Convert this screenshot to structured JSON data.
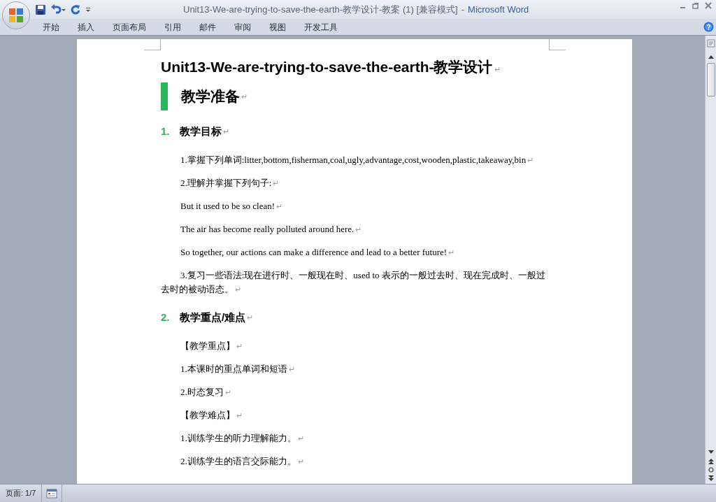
{
  "window": {
    "title": "Unit13-We-are-trying-to-save-the-earth-教学设计-教案 (1) [兼容模式]",
    "separator": "-",
    "app_name": "Microsoft Word"
  },
  "ribbon_tabs": [
    {
      "label": "开始"
    },
    {
      "label": "插入"
    },
    {
      "label": "页面布局"
    },
    {
      "label": "引用"
    },
    {
      "label": "邮件"
    },
    {
      "label": "审阅"
    },
    {
      "label": "视图"
    },
    {
      "label": "开发工具"
    }
  ],
  "document": {
    "blocks": [
      {
        "kind": "title",
        "text": "Unit13-We-are-trying-to-save-the-earth-教学设计",
        "end_mark": "↵"
      },
      {
        "kind": "section",
        "text": "教学准备",
        "end_mark": "↵"
      },
      {
        "kind": "numbered",
        "number": "1.",
        "text": "教学目标",
        "end_mark": "↵"
      },
      {
        "kind": "para",
        "text": "1.掌握下列单词:litter,bottom,fisherman,coal,ugly,advantage,cost,wooden,plastic,takeaway,bin",
        "end_mark": "↵"
      },
      {
        "kind": "para",
        "text": "2.理解并掌握下列句子:",
        "end_mark": "↵"
      },
      {
        "kind": "para",
        "text": "But it used to be so clean!",
        "end_mark": "↵"
      },
      {
        "kind": "para",
        "text": "The air has become really polluted around here.",
        "end_mark": "↵"
      },
      {
        "kind": "para",
        "text": "So together, our actions can make a difference and lead to a better future!",
        "end_mark": "↵"
      },
      {
        "kind": "para",
        "text": "3.复习一些语法:现在进行时、一般现在时、used to 表示的一般过去时、现在完成时、一般过去时的被动语态。",
        "end_mark": "↵"
      },
      {
        "kind": "numbered",
        "number": "2.",
        "text": "教学重点/难点",
        "end_mark": "↵"
      },
      {
        "kind": "para",
        "text": "【教学重点】",
        "end_mark": "↵"
      },
      {
        "kind": "para",
        "text": "1.本课时的重点单词和短语",
        "end_mark": "↵"
      },
      {
        "kind": "para",
        "text": "2.时态复习",
        "end_mark": "↵"
      },
      {
        "kind": "para",
        "text": "【教学难点】",
        "end_mark": "↵"
      },
      {
        "kind": "para",
        "text": "1.训练学生的听力理解能力。",
        "end_mark": "↵"
      },
      {
        "kind": "para",
        "text": "2.训练学生的语言交际能力。",
        "end_mark": "↵"
      }
    ]
  },
  "status_bar": {
    "page": "页面: 1/7"
  }
}
